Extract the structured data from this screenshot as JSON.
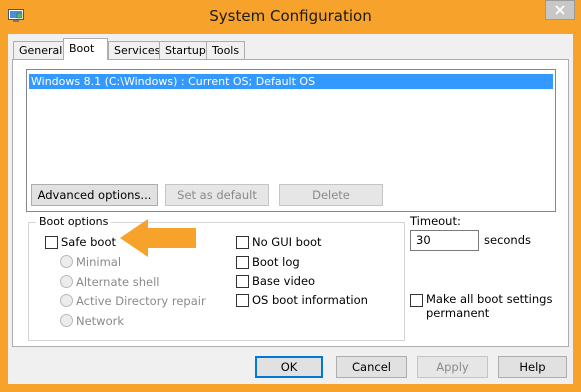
{
  "window": {
    "title": "System Configuration"
  },
  "tabs": [
    {
      "label": "General",
      "active": false
    },
    {
      "label": "Boot",
      "active": true
    },
    {
      "label": "Services",
      "active": false
    },
    {
      "label": "Startup",
      "active": false
    },
    {
      "label": "Tools",
      "active": false
    }
  ],
  "os_list": {
    "items": [
      "Windows 8.1 (C:\\Windows) : Current OS; Default OS"
    ],
    "selected_index": 0
  },
  "os_buttons": {
    "advanced": "Advanced options...",
    "set_default": "Set as default",
    "delete": "Delete"
  },
  "boot_options": {
    "label": "Boot options",
    "safe_boot": {
      "label": "Safe boot",
      "checked": false
    },
    "safe_boot_modes": [
      "Minimal",
      "Alternate shell",
      "Active Directory repair",
      "Network"
    ],
    "no_gui_boot": {
      "label": "No GUI boot",
      "checked": false
    },
    "boot_log": {
      "label": "Boot log",
      "checked": false
    },
    "base_video": {
      "label": "Base video",
      "checked": false
    },
    "os_boot_info": {
      "label": "OS boot information",
      "checked": false
    }
  },
  "timeout": {
    "label": "Timeout:",
    "value": "30",
    "unit": "seconds"
  },
  "make_permanent": {
    "line1": "Make all boot settings",
    "line2": "permanent",
    "checked": false
  },
  "footer": {
    "ok": "OK",
    "cancel": "Cancel",
    "apply": "Apply",
    "help": "Help"
  },
  "colors": {
    "highlight": "#3399ff",
    "annotation_arrow": "#f7a22b",
    "frame": "#f7a22b"
  }
}
